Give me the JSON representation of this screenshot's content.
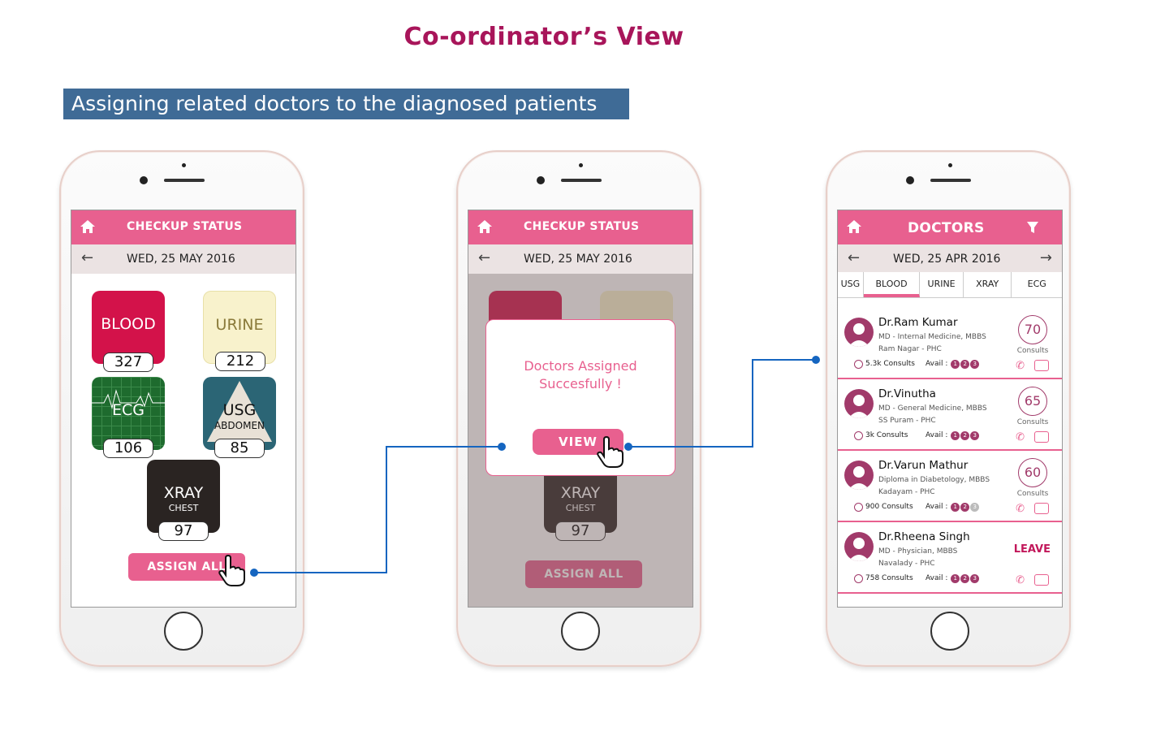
{
  "page": {
    "title": "Co-ordinator’s View",
    "banner": "Assigning related doctors to the diagnosed patients"
  },
  "phone1": {
    "header": "CHECKUP STATUS",
    "date": "WED, 25 MAY 2016",
    "tiles": [
      {
        "name": "BLOOD",
        "sub": "",
        "count": "327"
      },
      {
        "name": "URINE",
        "sub": "",
        "count": "212"
      },
      {
        "name": "ECG",
        "sub": "",
        "count": "106"
      },
      {
        "name": "USG",
        "sub": "ABDOMEN",
        "count": "85"
      },
      {
        "name": "XRAY",
        "sub": "CHEST",
        "count": "97"
      }
    ],
    "assign_label": "ASSIGN ALL"
  },
  "phone2": {
    "header": "CHECKUP STATUS",
    "date": "WED, 25 MAY 2016",
    "xray_name": "XRAY",
    "xray_sub": "CHEST",
    "xray_count": "97",
    "assign_label": "ASSIGN ALL",
    "modal_line1": "Doctors Assigned",
    "modal_line2": "Succesfully !",
    "view_label": "VIEW"
  },
  "phone3": {
    "header": "DOCTORS",
    "date": "WED, 25 APR 2016",
    "tabs": [
      "USG",
      "BLOOD",
      "URINE",
      "XRAY",
      "ECG"
    ],
    "active_tab": "BLOOD",
    "avail_label": "Avail :",
    "consults_label": "Consults",
    "doctors": [
      {
        "name": "Dr.Ram Kumar",
        "qual": "MD - Internal Medicine, MBBS",
        "loc": "Ram Nagar - PHC",
        "consults": "5.3k Consults",
        "count": "70",
        "slots": [
          1,
          1,
          1
        ],
        "leave": ""
      },
      {
        "name": "Dr.Vinutha",
        "qual": "MD - General Medicine, MBBS",
        "loc": "SS Puram - PHC",
        "consults": "3k Consults",
        "count": "65",
        "slots": [
          1,
          1,
          1
        ],
        "leave": ""
      },
      {
        "name": "Dr.Varun Mathur",
        "qual": "Diploma in Diabetology, MBBS",
        "loc": "Kadayam - PHC",
        "consults": "900 Consults",
        "count": "60",
        "slots": [
          1,
          1,
          0
        ],
        "leave": ""
      },
      {
        "name": "Dr.Rheena Singh",
        "qual": "MD - Physician, MBBS",
        "loc": "Navalady - PHC",
        "consults": "758 Consults",
        "count": "",
        "slots": [
          1,
          1,
          1
        ],
        "leave": "LEAVE"
      }
    ]
  },
  "colors": {
    "accent": "#e8608f",
    "title": "#a8155a",
    "banner": "#3f6b96",
    "blood": "#d3124a",
    "urine": "#f8f2cc",
    "ecg": "#1e6b2e",
    "usg": "#2b6575",
    "xray": "#2a2422",
    "connector": "#1565c0"
  }
}
